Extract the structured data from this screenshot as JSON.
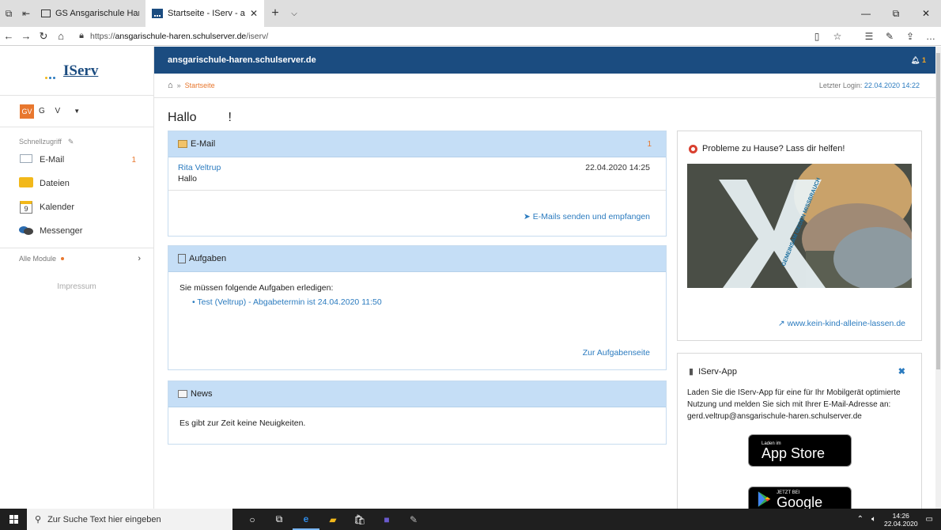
{
  "browser": {
    "tabs": [
      {
        "title": "GS Ansgarischule Haren (En",
        "active": false
      },
      {
        "title": "Startseite - IServ - ansg",
        "active": true
      }
    ],
    "url_prefix": "https://",
    "url_host": "ansgarischule-haren.schulserver.de",
    "url_path": "/iserv/"
  },
  "sidebar": {
    "logo_text": "IServ",
    "logo_dot_colors": [
      "#f2b81a",
      "#2b7bbf",
      "#2b7bbf"
    ],
    "user_initials": "GV",
    "user_name": "G V",
    "quick_label": "Schnellzugriff",
    "items": [
      {
        "label": "E-Mail",
        "count": "1"
      },
      {
        "label": "Dateien",
        "count": ""
      },
      {
        "label": "Kalender",
        "count": ""
      },
      {
        "label": "Messenger",
        "count": ""
      }
    ],
    "calendar_day": "9",
    "all_modules": "Alle Module",
    "impressum": "Impressum"
  },
  "header": {
    "domain": "ansgarischule-haren.schulserver.de",
    "notifications": "1",
    "breadcrumb_current": "Startseite",
    "last_login_label": "Letzter Login:",
    "last_login_value": "22.04.2020 14:22"
  },
  "main": {
    "greeting": "Hallo",
    "greeting_end": "!",
    "email_panel": {
      "title": "E-Mail",
      "count": "1",
      "from": "Rita Veltrup",
      "date": "22.04.2020 14:25",
      "subject": "Hallo",
      "action": "E-Mails senden und empfangen"
    },
    "tasks_panel": {
      "title": "Aufgaben",
      "text": "Sie müssen folgende Aufgaben erledigen:",
      "item": "Test (Veltrup) - Abgabetermin ist 24.04.2020 11:50",
      "action": "Zur Aufgabenseite"
    },
    "news_panel": {
      "title": "News",
      "text": "Es gibt zur Zeit keine Neuigkeiten."
    }
  },
  "right": {
    "help_title": "Probleme zu Hause? Lass dir helfen!",
    "help_image_text": "GEMEINSAM GEGEN MISSBRAUCH",
    "help_link": "www.kein-kind-alleine-lassen.de",
    "app_title": "IServ-App",
    "app_desc": "Laden Sie die IServ-App für eine für Ihr Mobilgerät optimierte Nutzung und melden Sie sich mit Ihrer E-Mail-Adresse an: gerd.veltrup@ansgarischule-haren.schulserver.de",
    "appstore_small": "Laden im",
    "appstore_big": "App Store",
    "play_small": "JETZT BEI",
    "play_big": "Google Play"
  },
  "taskbar": {
    "search_placeholder": "Zur Suche Text hier eingeben",
    "time": "14:26",
    "date": "22.04.2020"
  },
  "colors": {
    "brand_blue": "#1b4c80",
    "link_blue": "#2b7bbf",
    "accent_orange": "#e8772e",
    "panel_header": "#c5def6"
  }
}
